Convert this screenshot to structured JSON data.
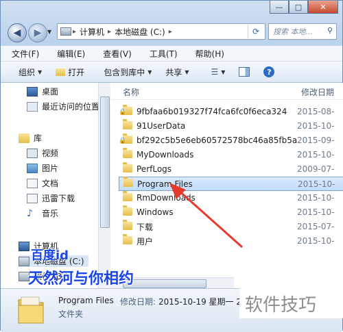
{
  "window": {
    "buttons": [
      "—",
      "□",
      "✕"
    ]
  },
  "address": {
    "segments": [
      "计算机",
      "本地磁盘 (C:)"
    ],
    "search_placeholder": "搜索 本地..."
  },
  "menu": [
    "文件(F)",
    "编辑(E)",
    "查看(V)",
    "工具(T)",
    "帮助(H)"
  ],
  "toolbar": {
    "organize": "组织",
    "open": "打开",
    "include": "包含到库中",
    "share": "共享"
  },
  "nav": {
    "items": [
      {
        "label": "桌面",
        "icon": "desktop-icon"
      },
      {
        "label": "最近访问的位置",
        "icon": "recent-icon"
      },
      {
        "label": "库",
        "icon": "library-icon"
      },
      {
        "label": "视频",
        "icon": "video-icon"
      },
      {
        "label": "图片",
        "icon": "picture-icon"
      },
      {
        "label": "文档",
        "icon": "document-icon"
      },
      {
        "label": "迅雷下载",
        "icon": "download-folder-icon"
      },
      {
        "label": "音乐",
        "icon": "music-icon"
      },
      {
        "label": "计算机",
        "icon": "computer-icon"
      },
      {
        "label": "本地磁盘 (C:)",
        "icon": "drive-icon"
      },
      {
        "label": "软件 (D:)",
        "icon": "drive-icon"
      }
    ]
  },
  "columns": {
    "name": "名称",
    "modified": "修改日期"
  },
  "files": [
    {
      "name": "9fbfaa6b019327f74fca6fc0f6eca324",
      "date": "2015-08-",
      "locked": true
    },
    {
      "name": "91UserData",
      "date": "2015-10-",
      "locked": false
    },
    {
      "name": "bf292c5b5e6eb60572578bc46a85fb5a",
      "date": "2015-09-",
      "locked": true
    },
    {
      "name": "MyDownloads",
      "date": "2015-10-",
      "locked": false
    },
    {
      "name": "PerfLogs",
      "date": "2009-07-",
      "locked": false
    },
    {
      "name": "Program Files",
      "date": "2015-10-",
      "locked": false,
      "selected": true
    },
    {
      "name": "RmDownloads",
      "date": "2015-10-",
      "locked": false
    },
    {
      "name": "Windows",
      "date": "2015-10-",
      "locked": false
    },
    {
      "name": "下载",
      "date": "2015-07-",
      "locked": false
    },
    {
      "name": "用户",
      "date": "2015-10-",
      "locked": false
    }
  ],
  "details": {
    "name": "Program Files",
    "modified_label": "修改日期:",
    "modified_value": "2015-10-19 星期一 21",
    "type": "文件夹"
  },
  "overlay": {
    "line1": "百度id",
    "line2": "天然河与你相约",
    "watermark": "软件技巧",
    "color": "#1b45e6"
  }
}
